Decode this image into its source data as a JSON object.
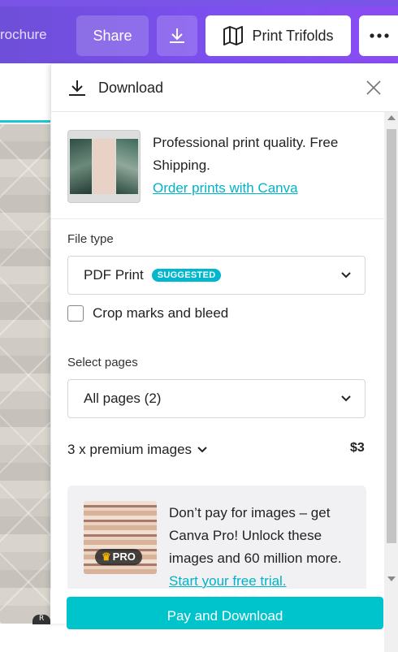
{
  "toolbar": {
    "doc_title_partial": "rochure",
    "share_label": "Share",
    "print_label": "Print Trifolds"
  },
  "panel": {
    "title": "Download",
    "promo": {
      "text": "Professional print quality. Free Shipping.",
      "link": "Order prints with Canva"
    },
    "file_type": {
      "label": "File type",
      "selected": "PDF Print",
      "badge": "SUGGESTED"
    },
    "crop_marks": {
      "label": "Crop marks and bleed",
      "checked": false
    },
    "select_pages": {
      "label": "Select pages",
      "selected": "All pages (2)"
    },
    "premium": {
      "label": "3 x premium images",
      "price": "$3"
    },
    "pro_card": {
      "badge": "PRO",
      "text": "Don’t pay for images – get Canva Pro! Unlock these images and 60 million more.",
      "link": "Start your free trial."
    },
    "pay_button": "Pay and Download"
  },
  "canvas": {
    "avatar_initial": "R"
  }
}
